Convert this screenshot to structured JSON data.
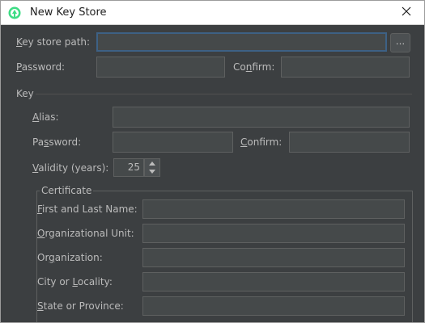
{
  "window": {
    "title": "New Key Store",
    "app_icon": "android-studio-icon",
    "close_icon": "close-icon"
  },
  "keystore": {
    "path_label_key": "K",
    "path_label_rest": "ey store path:",
    "path_value": "",
    "browse_label": "...",
    "password_label_key": "P",
    "password_label_rest": "assword:",
    "password_value": "",
    "confirm_label_pre": "Co",
    "confirm_label_key": "n",
    "confirm_label_rest": "firm:",
    "confirm_value": ""
  },
  "key": {
    "section_label": "Key",
    "alias_label_key": "A",
    "alias_label_rest": "lias:",
    "alias_value": "",
    "password_label_pre": "Pa",
    "password_label_key": "s",
    "password_label_rest": "sword:",
    "password_value": "",
    "confirm_label_key": "C",
    "confirm_label_rest": "onfirm:",
    "confirm_value": "",
    "validity_label_key": "V",
    "validity_label_rest": "alidity (years):",
    "validity_value": "25"
  },
  "certificate": {
    "section_label": "Certificate",
    "fields": [
      {
        "label_key": "F",
        "label_rest": "irst and Last Name:",
        "value": ""
      },
      {
        "label_key": "O",
        "label_rest": "rganizational Unit:",
        "value": ""
      },
      {
        "label_pre": "Or",
        "label_key": "g",
        "label_rest": "anization:",
        "value": ""
      },
      {
        "label_pre": "City or ",
        "label_key": "L",
        "label_rest": "ocality:",
        "value": ""
      },
      {
        "label_pre": "",
        "label_key": "S",
        "label_rest": "tate or Province:",
        "value": ""
      }
    ]
  },
  "colors": {
    "dialog_bg": "#3c3f41",
    "field_bg": "#45494a",
    "field_border": "#5e6060",
    "focus_border": "#3d6185",
    "text": "#bbbbbb"
  }
}
